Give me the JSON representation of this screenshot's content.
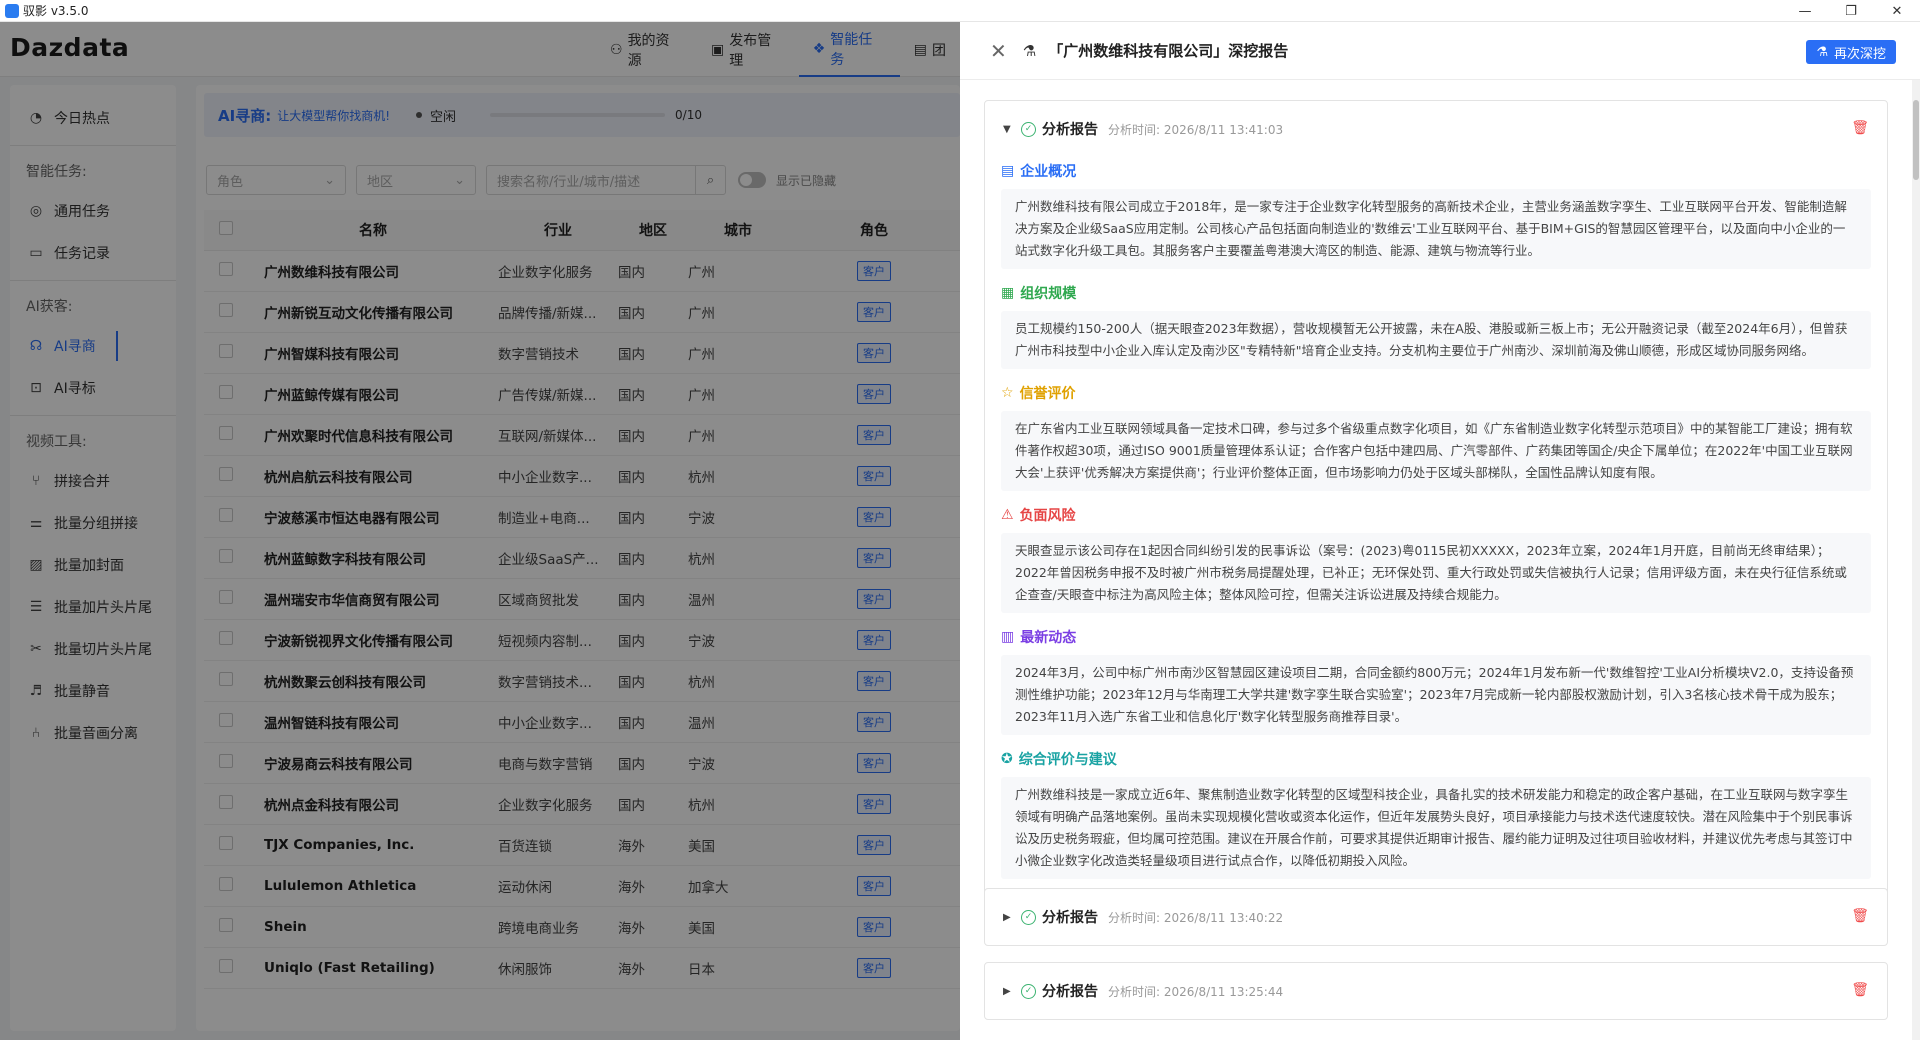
{
  "titlebar": {
    "title": "驭影 v3.5.0",
    "minimize": "—",
    "maximize": "❐",
    "close": "✕"
  },
  "brand": "Dazdata",
  "nav": [
    {
      "label": "我的资源",
      "icon": "users-icon"
    },
    {
      "label": "发布管理",
      "icon": "publish-icon"
    },
    {
      "label": "智能任务",
      "icon": "ai-task-icon"
    },
    {
      "label": "团",
      "icon": "team-icon"
    }
  ],
  "sidebar": {
    "hot": "今日热点",
    "sec_smart": "智能任务:",
    "general": "通用任务",
    "records": "任务记录",
    "sec_ai": "AI获客:",
    "ai_find": "AI寻商",
    "ai_mark": "AI寻标",
    "sec_video": "视频工具:",
    "tools": [
      "拼接合并",
      "批量分组拼接",
      "批量加封面",
      "批量加片头片尾",
      "批量切片头片尾",
      "批量静音",
      "批量音画分离"
    ]
  },
  "aibar": {
    "label": "AI寻商:",
    "sub": "让大模型帮你找商机!",
    "status": "空闲",
    "progress": 0,
    "count": "0/10"
  },
  "filters": {
    "role": "角色",
    "region": "地区",
    "search_placeholder": "搜索名称/行业/城市/描述",
    "show_hidden": "显示已隐藏"
  },
  "table": {
    "headers": [
      "名称",
      "行业",
      "地区",
      "城市",
      "角色"
    ],
    "rows": [
      [
        "广州数维科技有限公司",
        "企业数字化服务",
        "国内",
        "广州",
        "客户"
      ],
      [
        "广州新锐互动文化传播有限公司",
        "品牌传播/新媒...",
        "国内",
        "广州",
        "客户"
      ],
      [
        "广州智媒科技有限公司",
        "数字营销技术",
        "国内",
        "广州",
        "客户"
      ],
      [
        "广州蓝鲸传媒有限公司",
        "广告传媒/新媒...",
        "国内",
        "广州",
        "客户"
      ],
      [
        "广州欢聚时代信息科技有限公司",
        "互联网/新媒体...",
        "国内",
        "广州",
        "客户"
      ],
      [
        "杭州启航云科技有限公司",
        "中小企业数字...",
        "国内",
        "杭州",
        "客户"
      ],
      [
        "宁波慈溪市恒达电器有限公司",
        "制造业+电商...",
        "国内",
        "宁波",
        "客户"
      ],
      [
        "杭州蓝鲸数字科技有限公司",
        "企业级SaaS产...",
        "国内",
        "杭州",
        "客户"
      ],
      [
        "温州瑞安市华信商贸有限公司",
        "区域商贸批发",
        "国内",
        "温州",
        "客户"
      ],
      [
        "宁波新锐视界文化传播有限公司",
        "短视频内容制...",
        "国内",
        "宁波",
        "客户"
      ],
      [
        "杭州数聚云创科技有限公司",
        "数字营销技术...",
        "国内",
        "杭州",
        "客户"
      ],
      [
        "温州智链科技有限公司",
        "中小企业数字...",
        "国内",
        "温州",
        "客户"
      ],
      [
        "宁波易商云科技有限公司",
        "电商与数字营销",
        "国内",
        "宁波",
        "客户"
      ],
      [
        "杭州点金科技有限公司",
        "企业数字化服务",
        "国内",
        "杭州",
        "客户"
      ],
      [
        "TJX Companies, Inc.",
        "百货连锁",
        "海外",
        "美国",
        "客户"
      ],
      [
        "Lululemon Athletica",
        "运动休闲",
        "海外",
        "加拿大",
        "客户"
      ],
      [
        "Shein",
        "跨境电商业务",
        "海外",
        "美国",
        "客户"
      ],
      [
        "Uniqlo (Fast Retailing)",
        "休闲服饰",
        "海外",
        "日本",
        "客户"
      ]
    ]
  },
  "drawer": {
    "title": "「广州数维科技有限公司」深挖报告",
    "redig": "再次深挖",
    "reports": [
      {
        "title": "分析报告",
        "time": "分析时间: 2026/8/11 13:41:03",
        "sections": [
          {
            "icon": "doc-icon",
            "color": "#2a6ef5",
            "title": "企业概况",
            "body": "广州数维科技有限公司成立于2018年，是一家专注于企业数字化转型服务的高新技术企业，主营业务涵盖数字孪生、工业互联网平台开发、智能制造解决方案及企业级SaaS应用定制。公司核心产品包括面向制造业的'数维云'工业互联网平台、基于BIM+GIS的智慧园区管理平台，以及面向中小企业的一站式数字化升级工具包。其服务客户主要覆盖粤港澳大湾区的制造、能源、建筑与物流等行业。"
          },
          {
            "icon": "grid-icon",
            "color": "#2fa84f",
            "title": "组织规模",
            "body": "员工规模约150-200人（据天眼查2023年数据），营收规模暂无公开披露，未在A股、港股或新三板上市；无公开融资记录（截至2024年6月），但曾获广州市科技型中小企业入库认定及南沙区\"专精特新\"培育企业支持。分支机构主要位于广州南沙、深圳前海及佛山顺德，形成区域协同服务网络。"
          },
          {
            "icon": "star-icon",
            "color": "#e0a100",
            "title": "信誉评价",
            "body": "在广东省内工业互联网领域具备一定技术口碑，参与过多个省级重点数字化项目，如《广东省制造业数字化转型示范项目》中的某智能工厂建设；拥有软件著作权超30项，通过ISO 9001质量管理体系认证；合作客户包括中建四局、广汽零部件、广药集团等国企/央企下属单位；在2022年'中国工业互联网大会'上获评'优秀解决方案提供商'；行业评价整体正面，但市场影响力仍处于区域头部梯队，全国性品牌认知度有限。"
          },
          {
            "icon": "warning-icon",
            "color": "#e64545",
            "title": "负面风险",
            "body": "天眼查显示该公司存在1起因合同纠纷引发的民事诉讼（案号：(2023)粤0115民初XXXXX，2023年立案，2024年1月开庭，目前尚无终审结果）；2022年曾因税务申报不及时被广州市税务局提醒处理，已补正；无环保处罚、重大行政处罚或失信被执行人记录；信用评级方面，未在央行征信系统或企查查/天眼查中标注为高风险主体；整体风险可控，但需关注诉讼进展及持续合规能力。"
          },
          {
            "icon": "news-icon",
            "color": "#7b3fe4",
            "title": "最新动态",
            "body": "2024年3月，公司中标广州市南沙区智慧园区建设项目二期，合同金额约800万元；2024年1月发布新一代'数维智控'工业AI分析模块V2.0，支持设备预测性维护功能；2023年12月与华南理工大学共建'数字孪生联合实验室'；2023年7月完成新一轮内部股权激励计划，引入3名核心技术骨干成为股东；2023年11月入选广东省工业和信息化厅'数字化转型服务商推荐目录'。"
          },
          {
            "icon": "bulb-icon",
            "color": "#1aa3a3",
            "title": "综合评价与建议",
            "body": "广州数维科技是一家成立近6年、聚焦制造业数字化转型的区域型科技企业，具备扎实的技术研发能力和稳定的政企客户基础，在工业互联网与数字孪生领域有明确产品落地案例。虽尚未实现规模化营收或资本化运作，但近年发展势头良好，项目承接能力与技术迭代速度较快。潜在风险集中于个别民事诉讼及历史税务瑕疵，但均属可控范围。建议在开展合作前，可要求其提供近期审计报告、履约能力证明及过往项目验收材料，并建议优先考虑与其签订中小微企业数字化改造类轻量级项目进行试点合作，以降低初期投入风险。"
          }
        ]
      },
      {
        "title": "分析报告",
        "time": "分析时间: 2026/8/11 13:40:22"
      },
      {
        "title": "分析报告",
        "time": "分析时间: 2026/8/11 13:25:44"
      }
    ]
  }
}
